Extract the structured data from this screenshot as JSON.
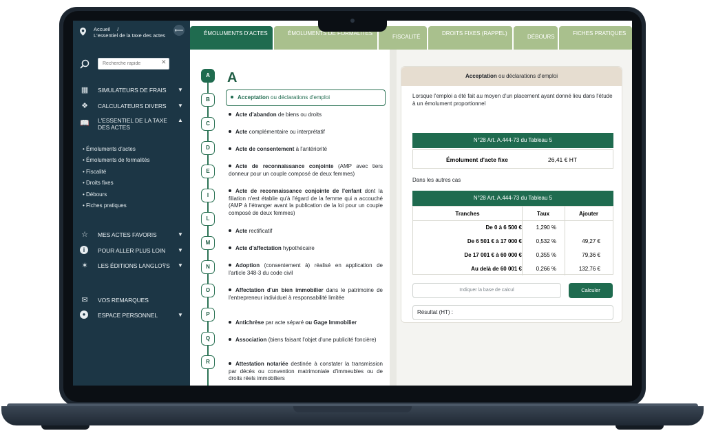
{
  "breadcrumb": {
    "home": "Accueil",
    "separator": "/",
    "current": "L'essentiel de la taxe des actes"
  },
  "collapse_icon": "arrow-left-icon",
  "search": {
    "placeholder": "Recherche rapide",
    "clear_icon": "close-icon"
  },
  "sidebar": {
    "items": [
      {
        "label": "SIMULATEURS DE FRAIS",
        "icon": "qr-grid-icon"
      },
      {
        "label": "CALCULATEURS DIVERS",
        "icon": "cubes-icon"
      },
      {
        "label": "L'ESSENTIEL DE LA TAXE DES ACTES",
        "icon": "book-icon"
      }
    ],
    "sub_items": [
      "Émoluments d'actes",
      "Émoluments de formalités",
      "Fiscalité",
      "Droits fixes",
      "Débours",
      "Fiches pratiques"
    ],
    "items2": [
      {
        "label": "MES ACTES FAVORIS",
        "icon": "star-icon"
      },
      {
        "label": "POUR ALLER PLUS LOIN",
        "icon": "info-icon"
      },
      {
        "label": "LES ÉDITIONS LANGLOŸS",
        "icon": "logo-icon"
      }
    ],
    "items3": [
      {
        "label": "VOS REMARQUES",
        "icon": "mail-icon"
      },
      {
        "label": "ESPACE PERSONNEL",
        "icon": "user-icon"
      }
    ]
  },
  "tabs": [
    {
      "label": "ÉMOLUMENTS D'ACTES",
      "active": true
    },
    {
      "label": "ÉMOLUMENTS DE FORMALITÉS",
      "active": false
    },
    {
      "label": "FISCALITÉ",
      "active": false
    },
    {
      "label": "DROITS FIXES (RAPPEL)",
      "active": false
    },
    {
      "label": "DÉBOURS",
      "active": false
    },
    {
      "label": "FICHES PRATIQUES",
      "active": false
    }
  ],
  "alphabet": [
    "A",
    "B",
    "C",
    "D",
    "E",
    "I",
    "L",
    "M",
    "N",
    "O",
    "P",
    "Q",
    "R"
  ],
  "letter_heading": "A",
  "entries": [
    {
      "bold": "Acceptation",
      "rest": " ou déclarations d'emploi",
      "selected": true
    },
    {
      "bold": "Acte d'abandon",
      "rest": " de biens ou droits"
    },
    {
      "bold": "Acte",
      "rest": " complémentaire ou interprétatif"
    },
    {
      "bold": "Acte de consentement",
      "rest": " à l'antériorité"
    },
    {
      "bold": "Acte de reconnaissance conjointe",
      "rest": " (AMP avec tiers donneur pour un couple composé de deux femmes)"
    },
    {
      "bold": "Acte de reconnaissance conjointe de l'enfant",
      "rest": " dont la filiation n'est établie qu'à l'égard de la femme qui a accouché (AMP à l'étranger avant la publication de la loi pour un couple composé de deux femmes)"
    },
    {
      "bold": "Acte",
      "rest": " rectificatif"
    },
    {
      "bold": "Acte d'affectation",
      "rest": " hypothécaire"
    },
    {
      "bold": "Adoption",
      "rest": " (consentement à) réalisé en application de l'article 348-3 du code civil"
    },
    {
      "bold": "Affectation d'un bien immobilier",
      "rest": " dans le patrimoine de l'entrepreneur individuel à responsabilité limitée"
    },
    {
      "bold": "Antichrèse",
      "rest": " par acte séparé ",
      "bold2": "ou Gage Immobilier"
    },
    {
      "bold": "Association",
      "rest": " (biens faisant l'objet d'une publicité foncière)"
    },
    {
      "bold": "Attestation notariée",
      "rest": " destinée à constater la transmission par décès ou convention matrimoniale d'immeubles ou de droits réels immobiliers"
    }
  ],
  "panel": {
    "title_bold": "Acceptation",
    "title_rest": " ou déclarations d'emploi",
    "intro": "Lorsque l'emploi a été fait au moyen d'un placement ayant donné lieu dans l'étude à un émolument proportionnel",
    "table1": {
      "header": "N°28 Art. A.444-73 du Tableau 5",
      "label": "Émolument d'acte fixe",
      "value": "26,41 € HT"
    },
    "other_cases": "Dans les autres cas",
    "table2": {
      "header": "N°28 Art. A.444-73 du Tableau 5",
      "columns": [
        "Tranches",
        "Taux",
        "Ajouter"
      ],
      "rows": [
        {
          "tranche": "De 0 à 6 500 €",
          "taux": "1,290 %",
          "ajouter": ""
        },
        {
          "tranche": "De 6 501 € à 17 000 €",
          "taux": "0,532 %",
          "ajouter": "49,27 €"
        },
        {
          "tranche": "De 17 001 € à 60 000 €",
          "taux": "0,355 %",
          "ajouter": "79,36 €"
        },
        {
          "tranche": "Au delà de 60 001 €",
          "taux": "0,266 %",
          "ajouter": "132,76 €"
        }
      ]
    },
    "calc_placeholder": "Indiquer la base de calcul",
    "calc_button": "Calculer",
    "result_label": "Résultat (HT) :"
  }
}
